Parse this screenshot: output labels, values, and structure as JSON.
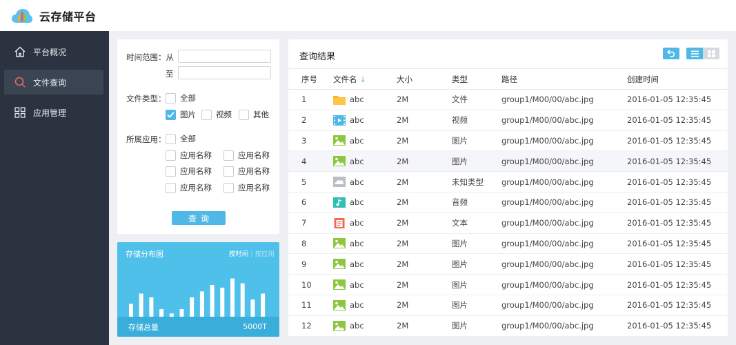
{
  "app": {
    "title": "云存储平台"
  },
  "sidebar": {
    "items": [
      {
        "label": "平台概况",
        "icon": "home-icon"
      },
      {
        "label": "文件查询",
        "icon": "search-icon",
        "active": true
      },
      {
        "label": "应用管理",
        "icon": "apps-grid-icon"
      }
    ]
  },
  "filter": {
    "time_range_label": "时间范围：从",
    "to_label": "至",
    "from_value": "",
    "to_value": "",
    "file_type_label": "文件类型：",
    "file_types": [
      {
        "label": "全部",
        "checked": false
      },
      {
        "label": "图片",
        "checked": true
      },
      {
        "label": "视频",
        "checked": false
      },
      {
        "label": "其他",
        "checked": false
      }
    ],
    "app_label": "所属应用：",
    "apps": [
      {
        "label": "全部",
        "checked": false
      },
      {
        "label": "应用名称",
        "checked": false
      },
      {
        "label": "应用名称",
        "checked": false
      },
      {
        "label": "应用名称",
        "checked": false
      },
      {
        "label": "应用名称",
        "checked": false
      },
      {
        "label": "应用名称",
        "checked": false
      },
      {
        "label": "应用名称",
        "checked": false
      }
    ],
    "query_button": "查询"
  },
  "storage": {
    "title": "存储分布图",
    "toggle_time": "按时间",
    "toggle_sep": "|",
    "toggle_app": "按应用",
    "bars": [
      0.24,
      0.43,
      0.36,
      0.14,
      0.06,
      0.14,
      0.36,
      0.47,
      0.59,
      0.54,
      0.71,
      0.62,
      0.32,
      0.43
    ],
    "total_label": "存储总量",
    "total_value": "5000T",
    "colors": {
      "panel": "#4fc0ea",
      "footer": "#3aaedb",
      "bar": "#ffffff"
    }
  },
  "results": {
    "title": "查询结果",
    "columns": [
      "序号",
      "文件名",
      "大小",
      "类型",
      "路径",
      "创建时间"
    ],
    "rows": [
      {
        "idx": "1",
        "icon": "folder-icon",
        "name": "abc",
        "size": "2M",
        "type": "文件",
        "path": "group1/M00/00/abc.jpg",
        "time": "2016-01-05 12:35:45"
      },
      {
        "idx": "2",
        "icon": "video-file-icon",
        "name": "abc",
        "size": "2M",
        "type": "视频",
        "path": "group1/M00/00/abc.jpg",
        "time": "2016-01-05 12:35:45"
      },
      {
        "idx": "3",
        "icon": "image-file-icon",
        "name": "abc",
        "size": "2M",
        "type": "图片",
        "path": "group1/M00/00/abc.jpg",
        "time": "2016-01-05 12:35:45"
      },
      {
        "idx": "4",
        "icon": "image-file-icon",
        "name": "abc",
        "size": "2M",
        "type": "图片",
        "path": "group1/M00/00/abc.jpg",
        "time": "2016-01-05 12:35:45",
        "highlight": true
      },
      {
        "idx": "5",
        "icon": "unknown-file-icon",
        "name": "abc",
        "size": "2M",
        "type": "未知类型",
        "path": "group1/M00/00/abc.jpg",
        "time": "2016-01-05 12:35:45"
      },
      {
        "idx": "6",
        "icon": "audio-file-icon",
        "name": "abc",
        "size": "2M",
        "type": "音频",
        "path": "group1/M00/00/abc.jpg",
        "time": "2016-01-05 12:35:45"
      },
      {
        "idx": "7",
        "icon": "text-file-icon",
        "name": "abc",
        "size": "2M",
        "type": "文本",
        "path": "group1/M00/00/abc.jpg",
        "time": "2016-01-05 12:35:45"
      },
      {
        "idx": "8",
        "icon": "image-file-icon",
        "name": "abc",
        "size": "2M",
        "type": "图片",
        "path": "group1/M00/00/abc.jpg",
        "time": "2016-01-05 12:35:45"
      },
      {
        "idx": "9",
        "icon": "image-file-icon",
        "name": "abc",
        "size": "2M",
        "type": "图片",
        "path": "group1/M00/00/abc.jpg",
        "time": "2016-01-05 12:35:45"
      },
      {
        "idx": "10",
        "icon": "image-file-icon",
        "name": "abc",
        "size": "2M",
        "type": "图片",
        "path": "group1/M00/00/abc.jpg",
        "time": "2016-01-05 12:35:45"
      },
      {
        "idx": "11",
        "icon": "image-file-icon",
        "name": "abc",
        "size": "2M",
        "type": "图片",
        "path": "group1/M00/00/abc.jpg",
        "time": "2016-01-05 12:35:45"
      },
      {
        "idx": "12",
        "icon": "image-file-icon",
        "name": "abc",
        "size": "2M",
        "type": "图片",
        "path": "group1/M00/00/abc.jpg",
        "time": "2016-01-05 12:35:45"
      }
    ],
    "tools": [
      "back-icon",
      "list-view-icon",
      "grid-view-icon"
    ],
    "colors": {
      "accent": "#4fb8e6",
      "row_highlight": "#f4f6f9"
    }
  }
}
